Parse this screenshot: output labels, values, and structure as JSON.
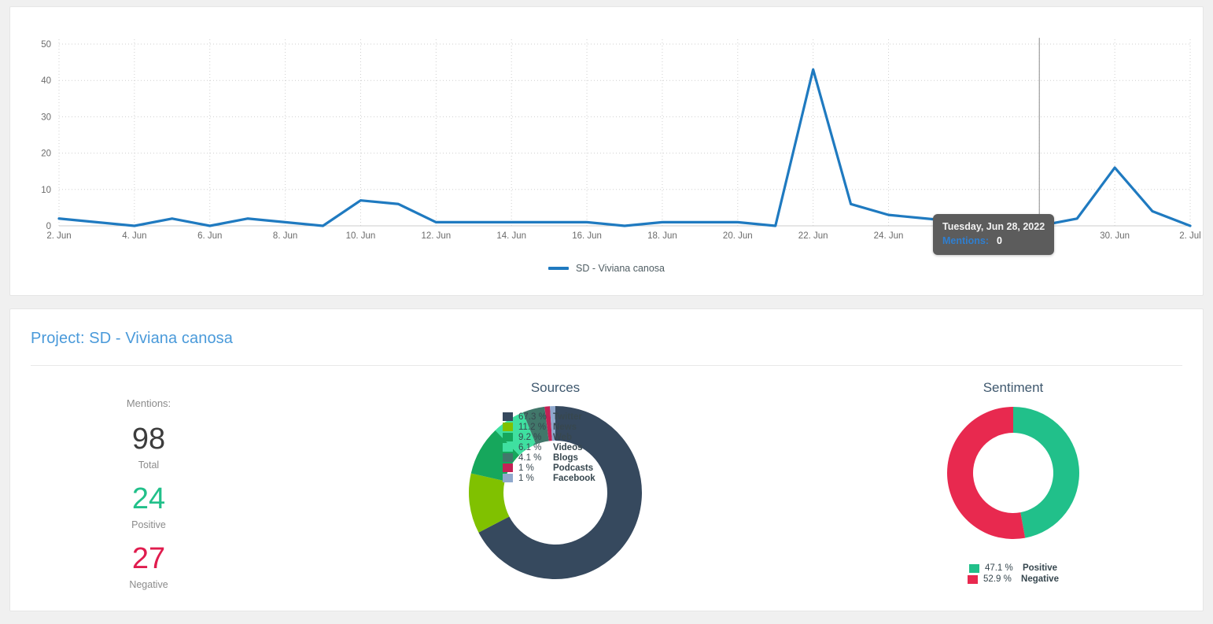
{
  "timeline": {
    "legend_label": "SD - Viviana canosa",
    "line_color": "#1f7ac0",
    "tooltip": {
      "date": "Tuesday, Jun 28, 2022",
      "metric_label": "Mentions:",
      "metric_value": "0"
    }
  },
  "project": {
    "title": "Project: SD - Viviana canosa",
    "metrics_caption": "Mentions:",
    "metrics": [
      {
        "value": "98",
        "label": "Total",
        "color": "#3c3c3c"
      },
      {
        "value": "24",
        "label": "Positive",
        "color": "#21c08a"
      },
      {
        "value": "27",
        "label": "Negative",
        "color": "#e01c4e"
      }
    ],
    "sources_heading": "Sources",
    "sentiment_heading": "Sentiment"
  },
  "chart_data": [
    {
      "type": "line",
      "title": "",
      "xlabel": "",
      "ylabel": "",
      "ylim": [
        0,
        50
      ],
      "yticks": [
        0,
        10,
        20,
        30,
        40,
        50
      ],
      "grid": true,
      "legend_position": "bottom",
      "series": [
        {
          "name": "SD - Viviana canosa",
          "color": "#1f7ac0",
          "x": [
            "2. Jun",
            "3. Jun",
            "4. Jun",
            "5. Jun",
            "6. Jun",
            "7. Jun",
            "8. Jun",
            "9. Jun",
            "10. Jun",
            "11. Jun",
            "12. Jun",
            "13. Jun",
            "14. Jun",
            "15. Jun",
            "16. Jun",
            "17. Jun",
            "18. Jun",
            "19. Jun",
            "20. Jun",
            "21. Jun",
            "22. Jun",
            "23. Jun",
            "24. Jun",
            "25. Jun",
            "26. Jun",
            "27. Jun",
            "28. Jun",
            "29. Jun",
            "30. Jun",
            "1. Jul",
            "2. Jul"
          ],
          "values": [
            2,
            1,
            0,
            2,
            0,
            2,
            1,
            0,
            7,
            6,
            1,
            1,
            1,
            1,
            1,
            0,
            1,
            1,
            1,
            0,
            43,
            6,
            3,
            2,
            1,
            0,
            0,
            2,
            16,
            4,
            0
          ]
        }
      ],
      "tick_labels": [
        "2. Jun",
        "4. Jun",
        "6. Jun",
        "8. Jun",
        "10. Jun",
        "12. Jun",
        "14. Jun",
        "16. Jun",
        "18. Jun",
        "20. Jun",
        "22. Jun",
        "24. Jun",
        "28. Jun",
        "30. Jun",
        "2. Jul"
      ],
      "annotations": [
        {
          "type": "crosshair",
          "x": "28. Jun"
        },
        {
          "type": "tooltip",
          "x": "28. Jun",
          "text": "Tuesday, Jun 28, 2022",
          "metric": "Mentions:",
          "value": "0"
        }
      ]
    },
    {
      "type": "pie",
      "variant": "donut",
      "title": "Sources",
      "labels": [
        "Twitter",
        "News",
        "Web",
        "Videos",
        "Blogs",
        "Podcasts",
        "Facebook"
      ],
      "values": [
        67.3,
        11.2,
        9.2,
        6.1,
        4.1,
        1,
        1
      ],
      "value_labels": [
        "67.3 %",
        "11.2 %",
        "9.2 %",
        "6.1 %",
        "4.1 %",
        "1 %",
        "1 %"
      ],
      "colors": [
        "#36495e",
        "#80c100",
        "#16a75c",
        "#3fe0a0",
        "#41776a",
        "#c42155",
        "#8fa8cd"
      ],
      "legend_position": "right"
    },
    {
      "type": "pie",
      "variant": "donut",
      "title": "Sentiment",
      "labels": [
        "Positive",
        "Negative"
      ],
      "values": [
        47.1,
        52.9
      ],
      "value_labels": [
        "47.1 %",
        "52.9 %"
      ],
      "colors": [
        "#21c08a",
        "#e8294f"
      ],
      "legend_position": "bottom"
    }
  ]
}
